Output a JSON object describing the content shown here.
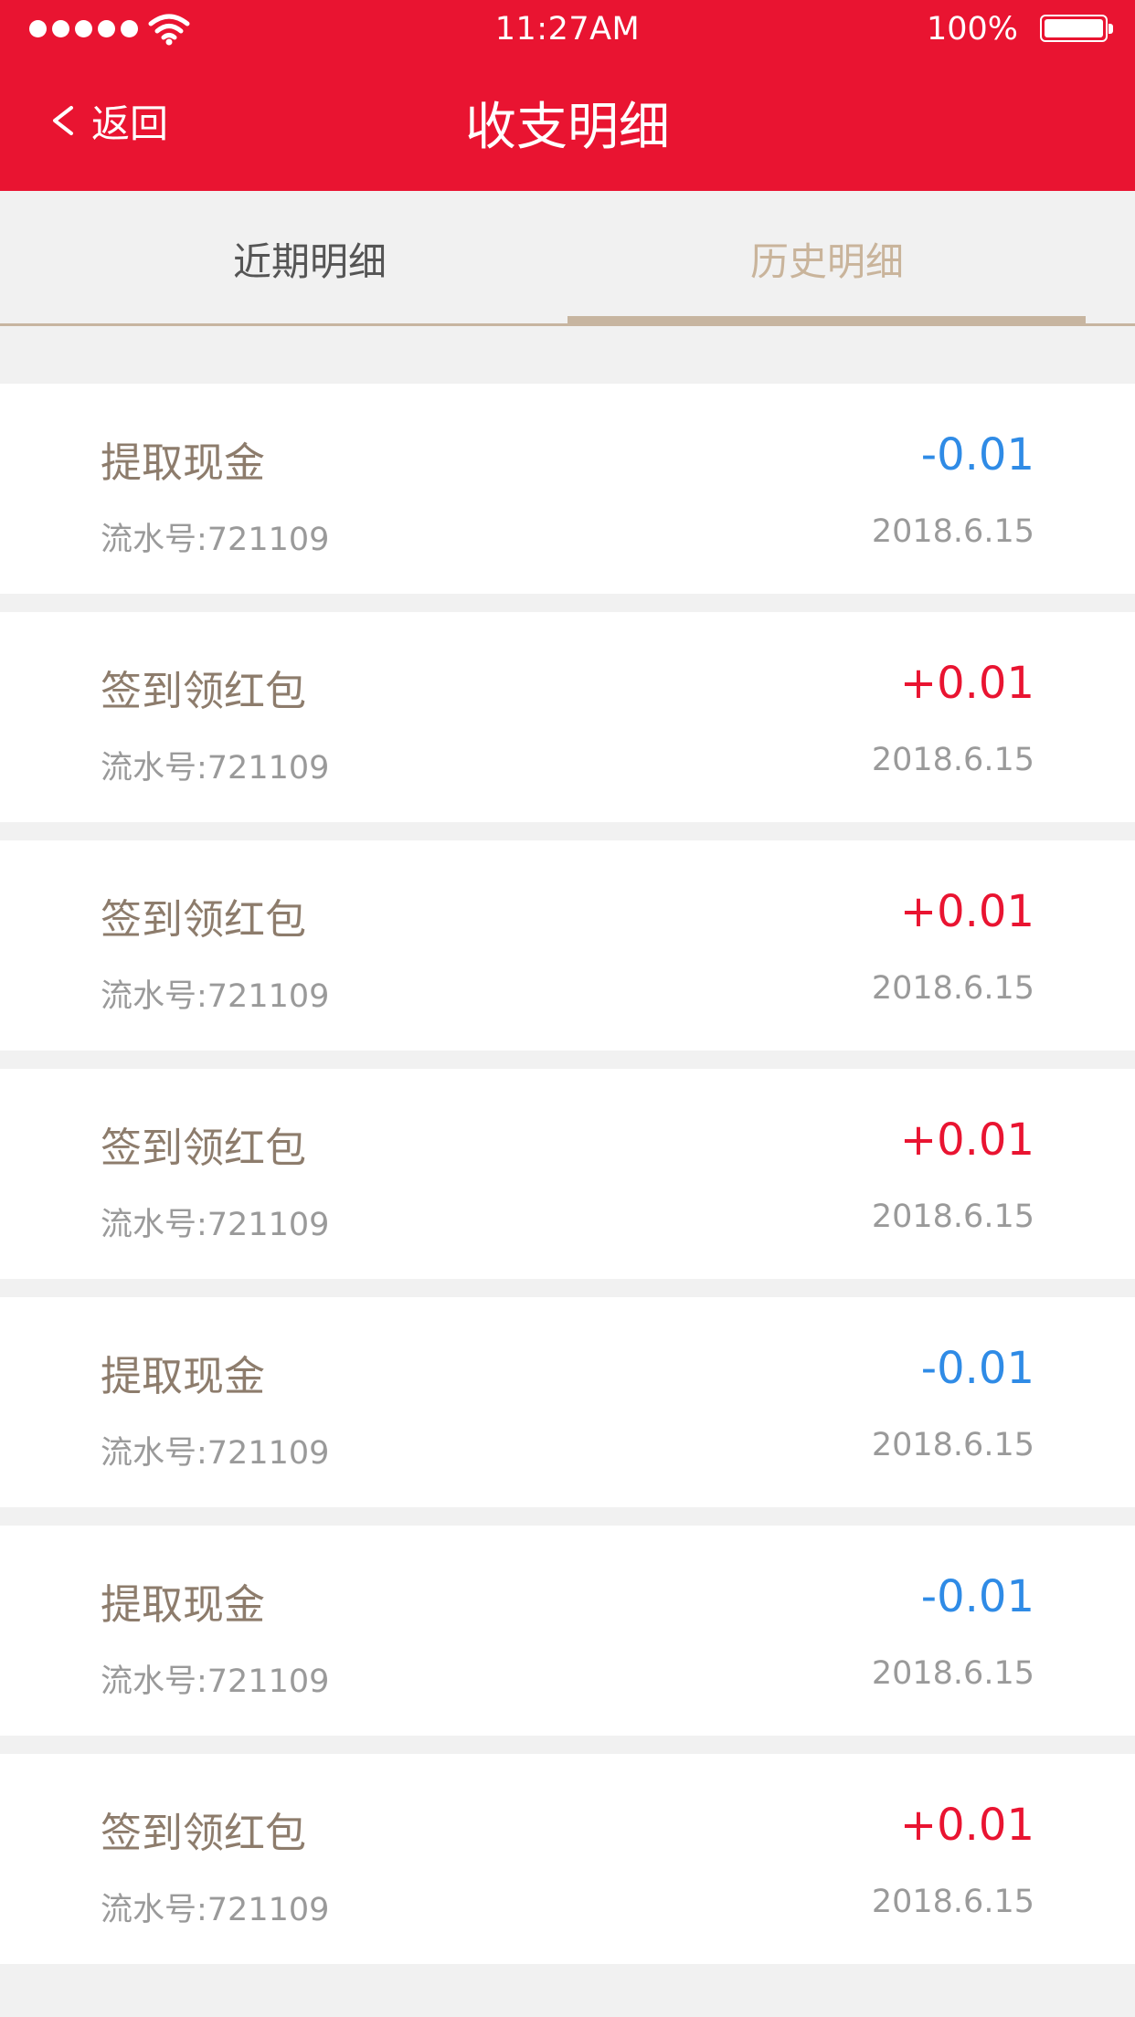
{
  "status_bar": {
    "time": "11:27AM",
    "battery": "100%"
  },
  "nav": {
    "back_label": "返回",
    "title": "收支明细"
  },
  "tabs": {
    "recent": "近期明细",
    "history": "历史明细",
    "active": "history"
  },
  "colors": {
    "header": "#e91431",
    "accent": "#c7b5a0",
    "negative": "#2f8be6",
    "positive": "#e91431"
  },
  "records": [
    {
      "title": "提取现金",
      "serial": "流水号:721109",
      "amount": "-0.01",
      "type": "neg",
      "date": "2018.6.15"
    },
    {
      "title": "签到领红包",
      "serial": "流水号:721109",
      "amount": "+0.01",
      "type": "pos",
      "date": "2018.6.15"
    },
    {
      "title": "签到领红包",
      "serial": "流水号:721109",
      "amount": "+0.01",
      "type": "pos",
      "date": "2018.6.15"
    },
    {
      "title": "签到领红包",
      "serial": "流水号:721109",
      "amount": "+0.01",
      "type": "pos",
      "date": "2018.6.15"
    },
    {
      "title": "提取现金",
      "serial": "流水号:721109",
      "amount": "-0.01",
      "type": "neg",
      "date": "2018.6.15"
    },
    {
      "title": "提取现金",
      "serial": "流水号:721109",
      "amount": "-0.01",
      "type": "neg",
      "date": "2018.6.15"
    },
    {
      "title": "签到领红包",
      "serial": "流水号:721109",
      "amount": "+0.01",
      "type": "pos",
      "date": "2018.6.15"
    }
  ]
}
